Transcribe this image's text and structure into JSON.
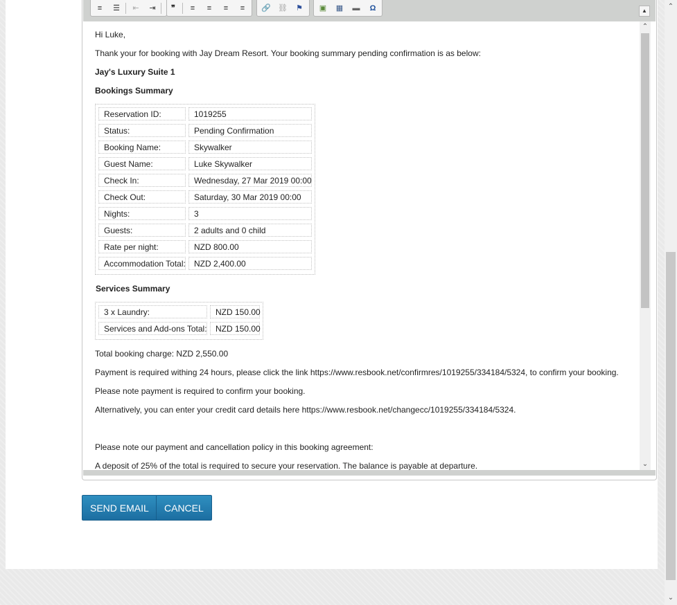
{
  "toolbar": {
    "buttons": [
      {
        "name": "numbered-list-icon",
        "glyph": "≡"
      },
      {
        "name": "bulleted-list-icon",
        "glyph": "☰"
      },
      {
        "name": "decrease-indent-icon",
        "glyph": "⇤"
      },
      {
        "name": "increase-indent-icon",
        "glyph": "⇥"
      },
      {
        "name": "blockquote-icon",
        "glyph": "❞"
      },
      {
        "name": "align-left-icon",
        "glyph": "≡"
      },
      {
        "name": "align-center-icon",
        "glyph": "≡"
      },
      {
        "name": "align-right-icon",
        "glyph": "≡"
      },
      {
        "name": "justify-icon",
        "glyph": "≡"
      },
      {
        "name": "link-icon",
        "glyph": "🔗"
      },
      {
        "name": "unlink-icon",
        "glyph": "⛓"
      },
      {
        "name": "anchor-flag-icon",
        "glyph": "⚑"
      },
      {
        "name": "image-icon",
        "glyph": "▣"
      },
      {
        "name": "table-icon",
        "glyph": "▦"
      },
      {
        "name": "horizontal-rule-icon",
        "glyph": "▬"
      },
      {
        "name": "special-char-icon",
        "glyph": "Ω"
      }
    ],
    "collapse_glyph": "▲"
  },
  "email": {
    "greeting": "Hi Luke,",
    "intro": "Thank your for booking with Jay Dream Resort. Your booking summary pending confirmation is as below:",
    "room_title": "Jay's Luxury Suite 1",
    "bookings_heading": "Bookings Summary",
    "bookings": [
      {
        "label": "Reservation ID:",
        "value": "1019255"
      },
      {
        "label": "Status:",
        "value": "Pending Confirmation"
      },
      {
        "label": "Booking Name:",
        "value": "Skywalker"
      },
      {
        "label": "Guest Name:",
        "value": "Luke Skywalker"
      },
      {
        "label": "Check In:",
        "value": "Wednesday, 27 Mar 2019 00:00"
      },
      {
        "label": "Check Out:",
        "value": "Saturday, 30 Mar 2019 00:00"
      },
      {
        "label": "Nights:",
        "value": "3"
      },
      {
        "label": "Guests:",
        "value": "2 adults and 0 child"
      },
      {
        "label": "Rate per night:",
        "value": "NZD 800.00"
      },
      {
        "label": "Accommodation Total:",
        "value": "NZD 2,400.00"
      }
    ],
    "services_heading": "Services Summary",
    "services": [
      {
        "label": "3 x Laundry:",
        "value": "NZD 150.00"
      },
      {
        "label": "Services and Add-ons Total:",
        "value": "NZD 150.00"
      }
    ],
    "total_charge": "Total booking charge: NZD 2,550.00",
    "payment_required": "Payment is required withing 24 hours, please click the link https://www.resbook.net/confirmres/1019255/334184/5324, to confirm your booking.",
    "payment_note": "Please note payment is required to confirm your booking.",
    "alternative": "Alternatively, you can enter your credit card details here https://www.resbook.net/changecc/1019255/334184/5324.",
    "policy_intro": "Please note our payment and cancellation policy in this booking agreement:",
    "deposit": "A deposit of 25% of the total is required to secure your reservation. The balance is payable at departure."
  },
  "scroll": {
    "up": "⌃",
    "down": "⌄"
  },
  "actions": {
    "send_label": "SEND EMAIL",
    "cancel_label": "CANCEL"
  }
}
